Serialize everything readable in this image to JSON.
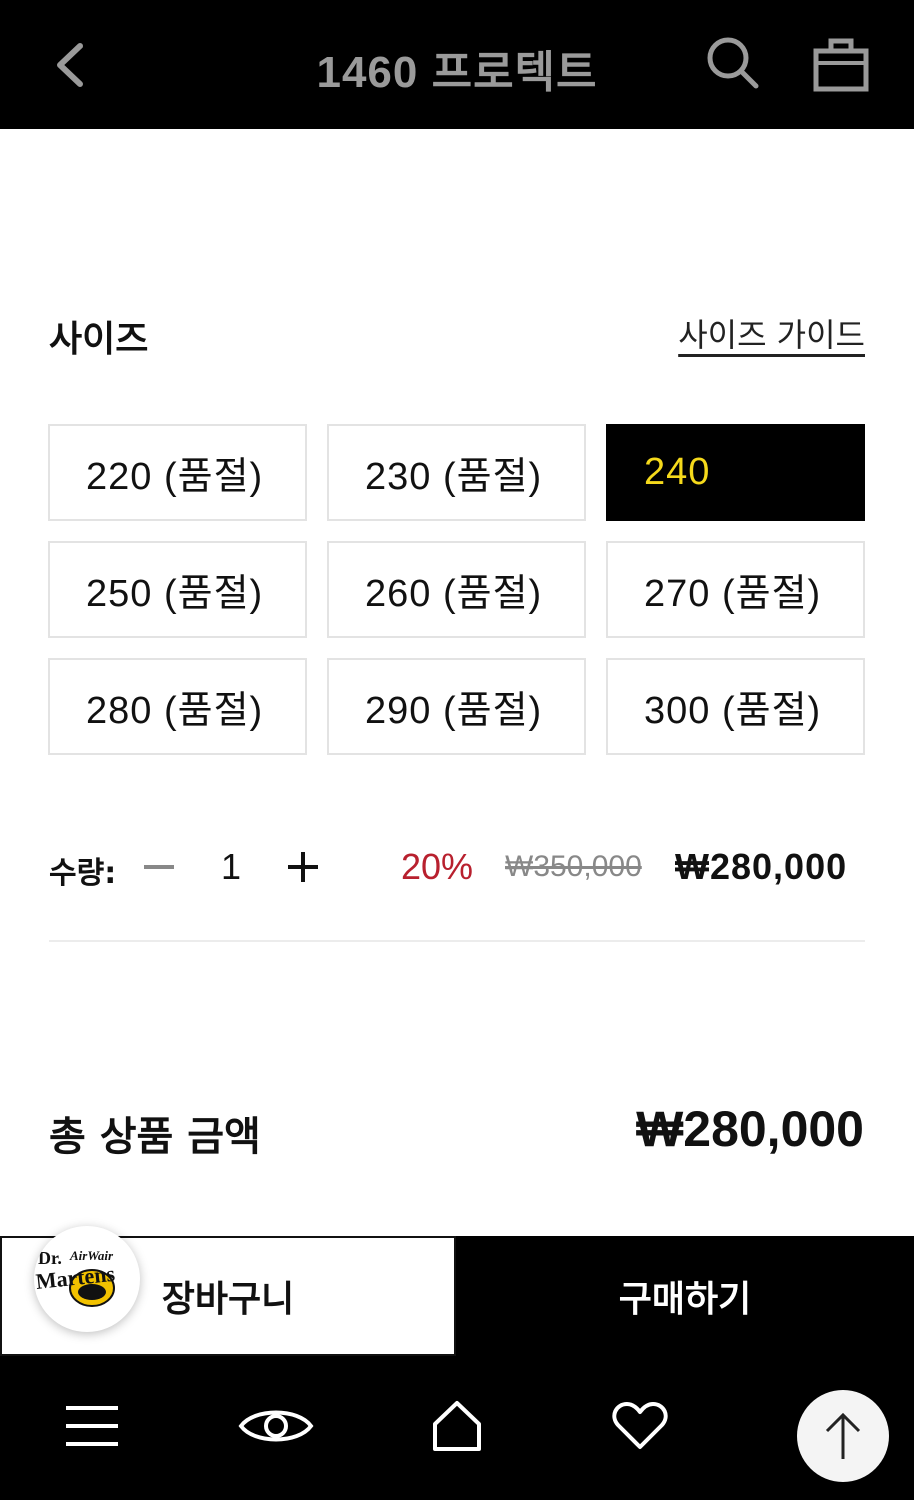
{
  "header": {
    "title": "1460 프로텍트",
    "back_icon": "chevron-left-icon",
    "search_icon": "search-icon",
    "bag_icon": "shopping-bag-icon"
  },
  "size_section": {
    "label": "사이즈",
    "guide_link": "사이즈 가이드",
    "options": [
      {
        "label": "220 (품절)",
        "selected": false
      },
      {
        "label": "230 (품절)",
        "selected": false
      },
      {
        "label": "240",
        "selected": true
      },
      {
        "label": "250 (품절)",
        "selected": false
      },
      {
        "label": "260 (품절)",
        "selected": false
      },
      {
        "label": "270 (품절)",
        "selected": false
      },
      {
        "label": "280 (품절)",
        "selected": false
      },
      {
        "label": "290 (품절)",
        "selected": false
      },
      {
        "label": "300 (품절)",
        "selected": false
      }
    ]
  },
  "quantity": {
    "label": "수량:",
    "value": "1",
    "discount": "20%",
    "original_price": "₩350,000",
    "sale_price": "₩280,000"
  },
  "total": {
    "label": "총 상품 금액",
    "value": "₩280,000"
  },
  "actions": {
    "cart_label": "장바구니",
    "buy_label": "구매하기"
  },
  "brand": {
    "logo_line1": "Dr.",
    "logo_line2": "AirWair",
    "logo_line3": "Martens"
  },
  "bottom_nav": {
    "items": [
      "menu-icon",
      "eye-icon",
      "home-icon",
      "heart-icon"
    ],
    "scroll_top_icon": "arrow-up-icon"
  },
  "colors": {
    "header_bg": "#000000",
    "selected_bg": "#000000",
    "selected_text": "#f5d91b",
    "discount": "#b8202e",
    "muted": "#888888"
  }
}
